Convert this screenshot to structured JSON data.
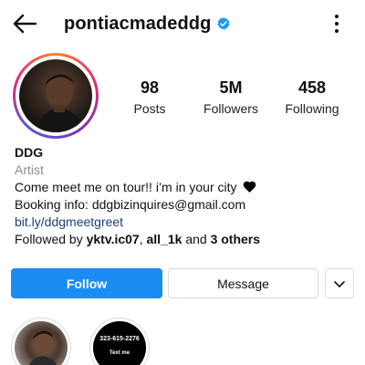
{
  "header": {
    "username": "pontiacmadeddg",
    "verified": true,
    "icons": {
      "back": "arrow-left-icon",
      "verified": "verified-badge-icon",
      "more": "more-vertical-icon"
    }
  },
  "stats": [
    {
      "value": "98",
      "label": "Posts"
    },
    {
      "value": "5M",
      "label": "Followers"
    },
    {
      "value": "458",
      "label": "Following"
    }
  ],
  "bio": {
    "name": "DDG",
    "category": "Artist",
    "line1": "Come meet me on tour!! i’m in your city",
    "line1_emoji": "black-heart-icon",
    "line2": "Booking info: ddgbizinquires@gmail.com",
    "link": "bit.ly/ddgmeetgreet",
    "followed_by_prefix": "Followed by ",
    "followed_by_user1": "yktv.ic07",
    "followed_by_sep": ", ",
    "followed_by_user2": "all_1k",
    "followed_by_and": " and ",
    "followed_by_others": "3 others"
  },
  "actions": {
    "follow_label": "Follow",
    "message_label": "Message",
    "dropdown_icon": "chevron-down-icon"
  },
  "highlights": [
    {
      "image": "highlight-photo"
    },
    {
      "phone": "323-615-2276",
      "text": "Text me"
    }
  ],
  "colors": {
    "follow_button": "#1a8cf2",
    "verified_badge": "#1d9bf0",
    "link": "#1f3d7a",
    "category": "#8e8e8e"
  }
}
